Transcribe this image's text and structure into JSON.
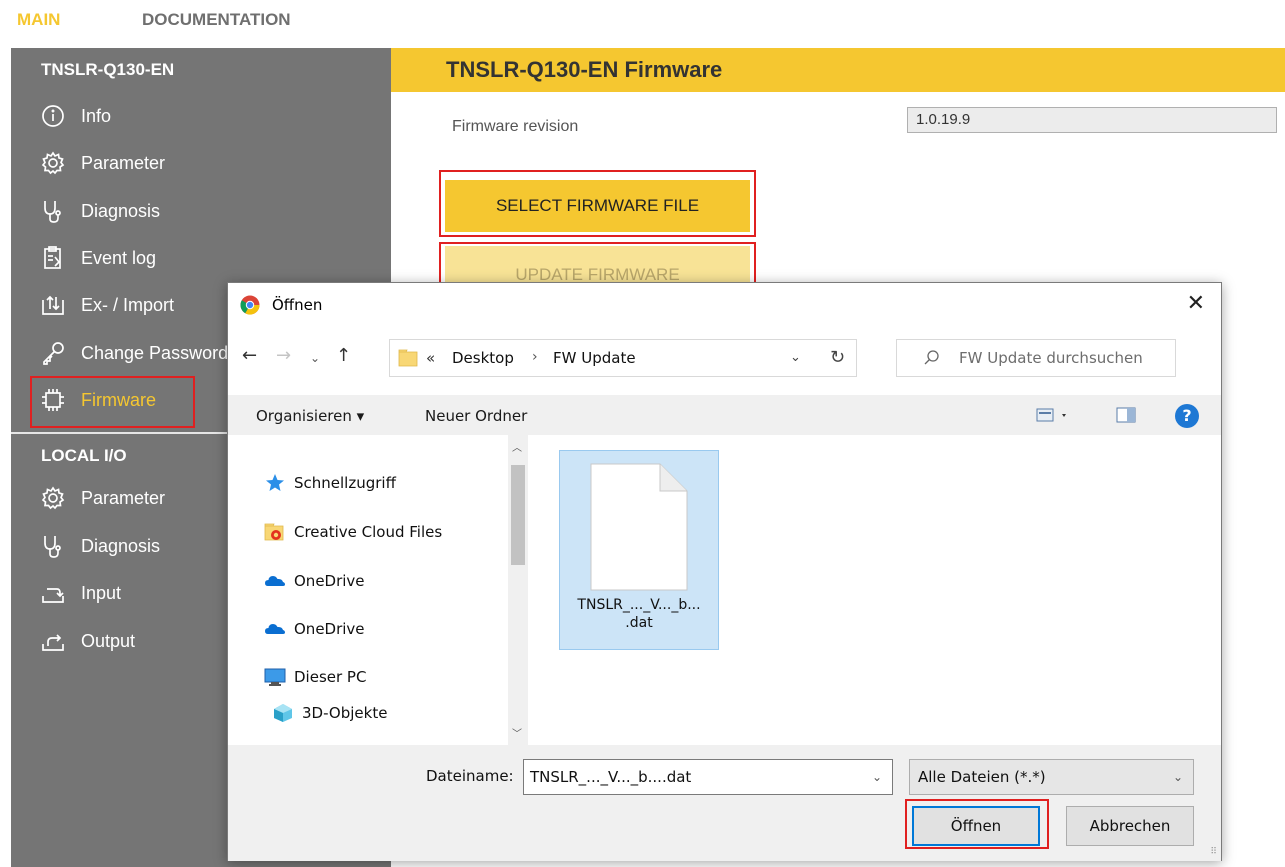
{
  "topnav": {
    "main": "MAIN",
    "documentation": "DOCUMENTATION"
  },
  "sidebar": {
    "device_header": "TNSLR-Q130-EN",
    "items": [
      {
        "label": "Info",
        "icon": "info-icon"
      },
      {
        "label": "Parameter",
        "icon": "gear-icon"
      },
      {
        "label": "Diagnosis",
        "icon": "stethoscope-icon"
      },
      {
        "label": "Event log",
        "icon": "event-log-icon"
      },
      {
        "label": "Ex- / Import",
        "icon": "import-export-icon"
      },
      {
        "label": "Change Password",
        "icon": "key-icon"
      },
      {
        "label": "Firmware",
        "icon": "chip-icon"
      }
    ],
    "local_header": "LOCAL I/O",
    "local_items": [
      {
        "label": "Parameter",
        "icon": "gear-icon"
      },
      {
        "label": "Diagnosis",
        "icon": "stethoscope-icon"
      },
      {
        "label": "Input",
        "icon": "input-icon"
      },
      {
        "label": "Output",
        "icon": "output-icon"
      }
    ]
  },
  "main": {
    "title": "TNSLR-Q130-EN Firmware",
    "firmware_revision_label": "Firmware revision",
    "firmware_revision_value": "1.0.19.9",
    "select_button": "SELECT FIRMWARE FILE",
    "update_button": "UPDATE FIRMWARE"
  },
  "dialog": {
    "title": "Öffnen",
    "address": {
      "prefix": "«",
      "crumb1": "Desktop",
      "separator": "›",
      "crumb2": "FW Update"
    },
    "search_placeholder": "FW Update durchsuchen",
    "toolbar": {
      "organize": "Organisieren ▾",
      "new_folder": "Neuer Ordner",
      "help": "?"
    },
    "tree": [
      {
        "label": "Schnellzugriff",
        "icon": "star-icon"
      },
      {
        "label": "Creative Cloud Files",
        "icon": "creative-cloud-folder-icon"
      },
      {
        "label": "OneDrive",
        "icon": "cloud-icon"
      },
      {
        "label": "OneDrive",
        "icon": "cloud-icon"
      },
      {
        "label": "Dieser PC",
        "icon": "computer-icon"
      },
      {
        "label": "3D-Objekte",
        "icon": "cube-icon"
      }
    ],
    "file": {
      "name": "TNSLR_..._V..._b...\n.dat"
    },
    "filename_label": "Dateiname:",
    "filename_value": "TNSLR_..._V..._b....dat",
    "filetype_value": "Alle Dateien (*.*)",
    "open_button": "Öffnen",
    "cancel_button": "Abbrechen"
  },
  "colors": {
    "accent": "#f5c730",
    "sidebar": "#757575",
    "highlight": "#e02020",
    "selection": "#cce4f7",
    "dialog_focus": "#0078d7"
  }
}
